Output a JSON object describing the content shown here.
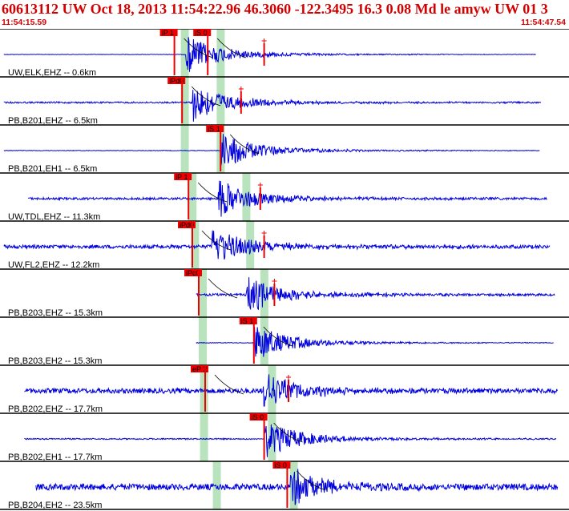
{
  "header": {
    "title": "60613112 UW Oct 18, 2013 11:54:22.96   46.3060 -122.3495 16.3 0.08 Md le amyw UW 01   3",
    "time_start": "11:54:15.59",
    "time_end": "11:54:47.54"
  },
  "colors": {
    "title": "#d40000",
    "trace": "#0000dd",
    "pick": "#ee0000",
    "window": "#b9e3bd",
    "divider": "#000000"
  },
  "chart_data": {
    "type": "seismogram",
    "time_range_s": [
      0,
      31.95
    ],
    "traces": [
      {
        "label": "UW,ELK,EHZ -- 0.6km",
        "picks": [
          {
            "label": "iP 1",
            "t": 13.6
          },
          {
            "label": "iS 0",
            "t": 16.2
          }
        ],
        "window_s": [
          14.1,
          16.9
        ],
        "noise": 0.07,
        "duration_s": [
          0.3,
          41.8
        ],
        "coda_s": 14.5,
        "amp_mark_s": 20.6
      },
      {
        "label": "PB,B201,EHZ -- 6.5km",
        "picks": [
          {
            "label": "iPd0",
            "t": 14.2
          }
        ],
        "window_s": [
          14.1,
          16.9
        ],
        "noise": 0.25,
        "duration_s": [
          0.3,
          42.2
        ],
        "coda_s": 15.0,
        "amp_mark_s": 18.8
      },
      {
        "label": "PB,B201,EH1 -- 6.5km",
        "picks": [
          {
            "label": "iS 1",
            "t": 17.2
          }
        ],
        "window_s": [
          14.1,
          16.9
        ],
        "noise": 0.09,
        "duration_s": [
          0.3,
          42.1
        ],
        "coda_s": 17.2
      },
      {
        "label": "UW,TDL,EHZ -- 11.3km",
        "picks": [
          {
            "label": "iP 1",
            "t": 14.7
          }
        ],
        "window_s": [
          14.7,
          18.9
        ],
        "noise": 0.35,
        "duration_s": [
          2.2,
          42.7
        ],
        "coda_s": 17.0,
        "amp_mark_s": 20.3
      },
      {
        "label": "UW,FL2,EHZ -- 12.2km",
        "picks": [
          {
            "label": "iPd0",
            "t": 15.0
          }
        ],
        "window_s": [
          14.9,
          19.2
        ],
        "noise": 0.55,
        "duration_s": [
          0.3,
          42.9
        ],
        "coda_s": 16.5,
        "amp_mark_s": 20.6
      },
      {
        "label": "PB,B203,EHZ -- 15.3km",
        "picks": [
          {
            "label": "iPc0",
            "t": 15.5
          }
        ],
        "window_s": [
          15.5,
          20.3
        ],
        "noise": 0.35,
        "duration_s": [
          15.3,
          43.3
        ],
        "coda_s": 19.2,
        "amp_mark_s": 21.4
      },
      {
        "label": "PB,B203,EH2 -- 15.3km",
        "picks": [
          {
            "label": "iS 1",
            "t": 19.8
          }
        ],
        "window_s": [
          15.5,
          20.3
        ],
        "noise": 0.1,
        "duration_s": [
          15.3,
          43.2
        ],
        "coda_s": 19.8
      },
      {
        "label": "PB,B202,EHZ -- 17.7km",
        "picks": [
          {
            "label": "eP 2",
            "t": 16.0
          }
        ],
        "window_s": [
          15.6,
          20.9
        ],
        "noise": 0.75,
        "duration_s": [
          1.9,
          43.6
        ],
        "coda_s": 20.5,
        "amp_mark_s": 22.5
      },
      {
        "label": "PB,B202,EH1 -- 17.7km",
        "picks": [
          {
            "label": "iS 0",
            "t": 20.6
          }
        ],
        "window_s": [
          15.6,
          20.9
        ],
        "noise": 0.2,
        "duration_s": [
          1.9,
          43.4
        ],
        "coda_s": 20.6
      },
      {
        "label": "PB,B204,EH2 -- 23.5km",
        "picks": [
          {
            "label": "iS 0",
            "t": 22.4
          }
        ],
        "window_s": [
          16.6,
          22.6
        ],
        "noise": 0.95,
        "duration_s": [
          2.8,
          44.7
        ],
        "coda_s": 22.6
      }
    ]
  }
}
